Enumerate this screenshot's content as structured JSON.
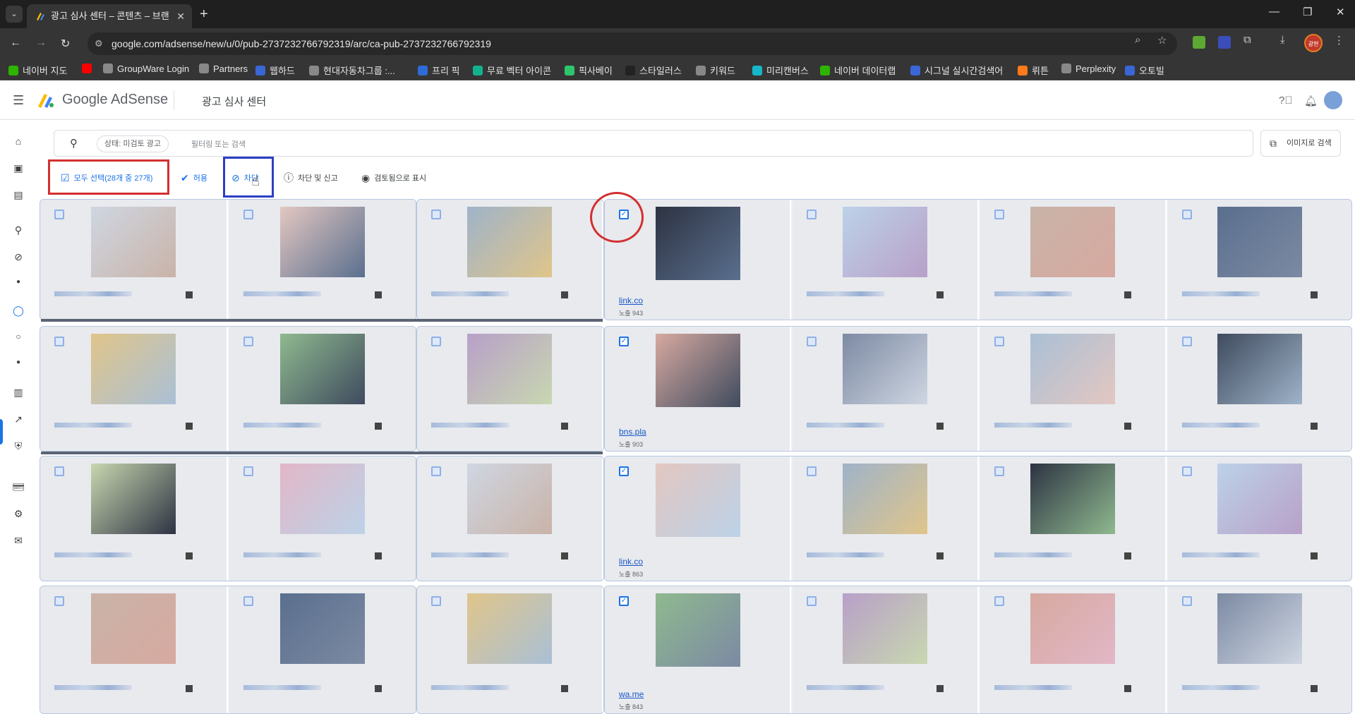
{
  "browser": {
    "tab_title": "광고 심사 센터 – 콘텐츠 – 브랜",
    "url": "google.com/adsense/new/u/0/pub-2737232766792319/arc/ca-pub-2737232766792319",
    "profile_label": "광현"
  },
  "bookmarks": [
    {
      "label": "네이버 지도",
      "color": "#2db400"
    },
    {
      "label": "",
      "color": "#ff0000"
    },
    {
      "label": "GroupWare Login",
      "color": "#888888"
    },
    {
      "label": "Partners",
      "color": "#888888"
    },
    {
      "label": "웹하드",
      "color": "#3a66d6"
    },
    {
      "label": "현대자동차그룹 :...",
      "color": "#888888"
    },
    {
      "label": "프리 픽",
      "color": "#2f6bd8"
    },
    {
      "label": "무료 벡터 아이콘",
      "color": "#13b28e"
    },
    {
      "label": "픽사베이",
      "color": "#2ec66d"
    },
    {
      "label": "스타일러스",
      "color": "#222222"
    },
    {
      "label": "키워드",
      "color": "#888888"
    },
    {
      "label": "미리캔버스",
      "color": "#17b6c9"
    },
    {
      "label": "네이버 데이터랩",
      "color": "#2db400"
    },
    {
      "label": "시그널 실시간검색어",
      "color": "#3a66d6"
    },
    {
      "label": "뤼튼",
      "color": "#ff7a1a"
    },
    {
      "label": "Perplexity",
      "color": "#888888"
    },
    {
      "label": "오토빌",
      "color": "#3a66d6"
    }
  ],
  "app": {
    "logo_text": "Google AdSense",
    "page_title": "광고 심사 센터"
  },
  "search": {
    "chip": "상태: 미검토 광고",
    "placeholder": "필터링 또는 검색",
    "image_search_label": "이미지로 검색"
  },
  "actions": {
    "select_all": "모두 선택(28개 중 27개)",
    "allow": "허용",
    "block": "차단",
    "block_report": "차단 및 신고",
    "mark_reviewed": "검토됨으로 표시"
  },
  "rows": [
    {
      "link": "link.co",
      "sub": "노출 943"
    },
    {
      "link": "bns.pla",
      "sub": "노출 903"
    },
    {
      "link": "link.co",
      "sub": "노출 863"
    },
    {
      "link": "wa.me",
      "sub": "노출 843"
    }
  ],
  "colors": {
    "accent": "#1a73e8",
    "highlight_red": "#d32f2f",
    "highlight_blue": "#2c3fc4"
  }
}
